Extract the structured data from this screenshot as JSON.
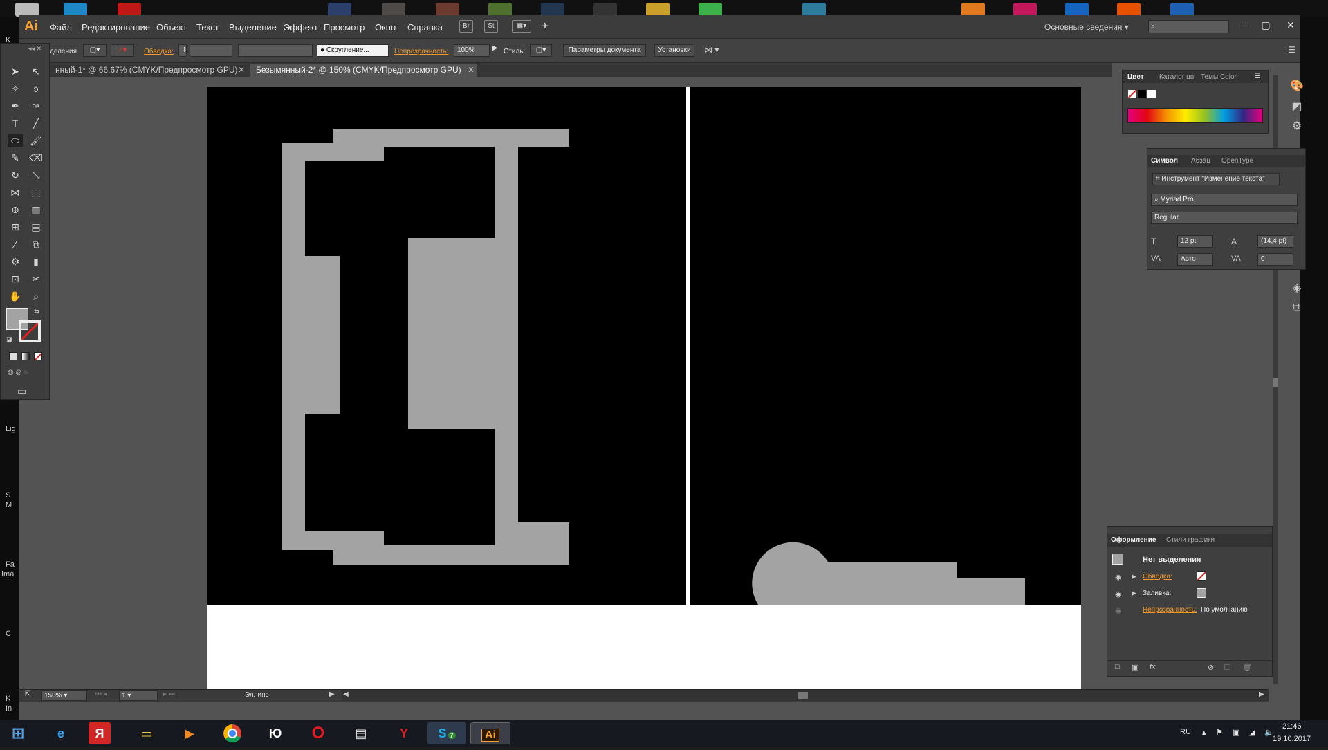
{
  "menubar": {
    "logo": "Ai",
    "items": [
      "Файл",
      "Редактирование",
      "Объект",
      "Текст",
      "Выделение",
      "Эффект",
      "Просмотр",
      "Окно",
      "Справка"
    ],
    "bridge": "Br",
    "stock": "St",
    "workspace": "Основные сведения"
  },
  "controlbar": {
    "selection_label": "деления",
    "stroke_label": "Обводка:",
    "brush_label": "Скругление...",
    "opacity_label": "Непрозрачность:",
    "opacity_value": "100%",
    "style_label": "Стиль:",
    "doc_settings": "Параметры документа",
    "preferences": "Установки"
  },
  "tabs": [
    {
      "label": "нный-1* @ 66,67% (CMYK/Предпросмотр GPU)",
      "active": false
    },
    {
      "label": "Безымянный-2* @ 150% (CMYK/Предпросмотр GPU)",
      "active": true
    }
  ],
  "color_panel": {
    "tabs": [
      "Цвет",
      "Каталог цв",
      "Темы Color"
    ]
  },
  "character_panel": {
    "tabs": [
      "Символ",
      "Абзац",
      "OpenType"
    ],
    "tool_text": "Инструмент \"Изменение текста\"",
    "font": "Myriad Pro",
    "style": "Regular",
    "size": "12 pt",
    "leading": "(14,4 pt)",
    "kerning": "Авто",
    "tracking": "0"
  },
  "appearance_panel": {
    "tabs": [
      "Оформление",
      "Стили графики"
    ],
    "title": "Нет выделения",
    "stroke_label": "Обводка:",
    "fill_label": "Заливка:",
    "opacity_label": "Непрозрачность:",
    "opacity_value": "По умолчанию",
    "fx": "fx."
  },
  "statusbar": {
    "zoom": "150%",
    "page": "1",
    "tool": "Эллипс"
  },
  "desktop_left_labels": [
    "K",
    "Lig",
    "S",
    "M",
    "Fa",
    "Ima",
    "C",
    "K",
    "In"
  ],
  "taskbar": {
    "apps": [
      "start",
      "ie",
      "yandex-browser",
      "explorer",
      "media-player",
      "chrome",
      "yu",
      "opera",
      "notepad",
      "yandex",
      "skype",
      "illustrator"
    ],
    "ai_label": "Ai",
    "skype_badge": "7",
    "yu_label": "Ю",
    "lang": "RU",
    "time": "21:46",
    "date": "19.10.2017"
  },
  "colors": {
    "accent_orange": "#f19a2a",
    "canvas_shape_gray": "#a3a3a3",
    "ai_brand": "#f7a233"
  }
}
